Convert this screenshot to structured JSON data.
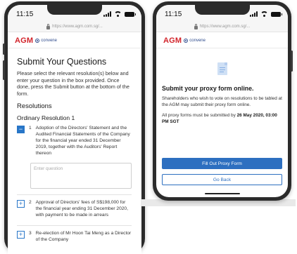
{
  "left_phone": {
    "status": {
      "time": "11:15"
    },
    "browser": {
      "url": "https://www.agm.com.sg/..."
    },
    "brand": {
      "logo": "AGM",
      "partner": "convene"
    },
    "form": {
      "title": "Submit Your Questions",
      "intro": "Please select the relevant resolution(s) below and enter your question in the box provided. Once done, press the Submit button at the bottom of the form.",
      "section_title": "Resolutions",
      "subsection_title": "Ordinary Resolution 1",
      "question_placeholder": "Enter question",
      "resolutions": [
        {
          "toggle": "−",
          "number": "1",
          "text": "Adoption of the Directors' Statement and the Audited Financial Statements of the Company for the financial year ended 31 December 2019, together with the Auditors' Report thereon"
        },
        {
          "toggle": "+",
          "number": "2",
          "text": "Approval of Directors' fees of S$198,000 for the financial year ending 31 December 2020, with payment to be made in arrears"
        },
        {
          "toggle": "+",
          "number": "3",
          "text": "Re-election of Mr Hoon Tai Meng as a Director of the Company"
        }
      ]
    }
  },
  "right_phone": {
    "status": {
      "time": "11:15"
    },
    "browser": {
      "url": "https://www.agm.com.sg/..."
    },
    "brand": {
      "logo": "AGM",
      "partner": "convene"
    },
    "content": {
      "icon": "document-list-icon",
      "title": "Submit your proxy form online.",
      "body": "Shareholders who wish to vote on resolutions to be tabled at the AGM may submit their proxy form online.",
      "deadline_prefix": "All proxy forms must be submitted by ",
      "deadline": "26 May 2020, 03:00 PM SGT",
      "primary_button": "Fill Out Proxy Form",
      "secondary_button": "Go Back"
    }
  },
  "colors": {
    "brand_red": "#d2232a",
    "accent_blue": "#2d6fc0",
    "frame": "#2b2b2b"
  }
}
